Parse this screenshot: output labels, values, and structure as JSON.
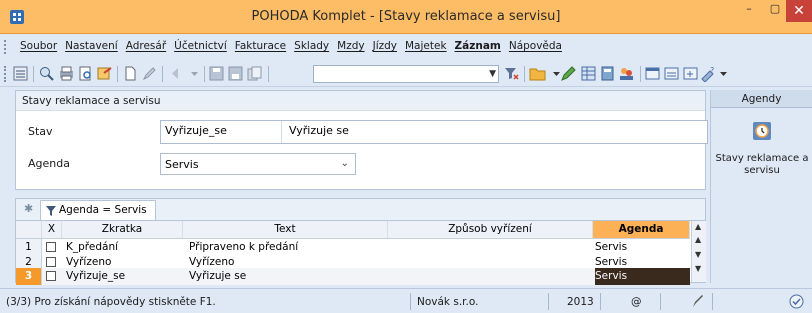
{
  "window": {
    "title": "POHODA Komplet - [Stavy reklamace a servisu]",
    "close_glyph": "✕",
    "min_glyph": "–",
    "max_glyph": "▢"
  },
  "menu": {
    "items": [
      {
        "label": "Soubor",
        "bold": false
      },
      {
        "label": "Nastavení",
        "bold": false
      },
      {
        "label": "Adresář",
        "bold": false
      },
      {
        "label": "Účetnictví",
        "bold": false
      },
      {
        "label": "Fakturace",
        "bold": false
      },
      {
        "label": "Sklady",
        "bold": false
      },
      {
        "label": "Mzdy",
        "bold": false
      },
      {
        "label": "Jízdy",
        "bold": false
      },
      {
        "label": "Majetek",
        "bold": false
      },
      {
        "label": "Záznam",
        "bold": true
      },
      {
        "label": "Nápověda",
        "bold": false
      }
    ]
  },
  "toolbar": {
    "search_value": ""
  },
  "form": {
    "title": "Stavy reklamace a servisu",
    "stav_label": "Stav",
    "stav_code": "Vyřizuje_se",
    "stav_text": "Vyřizuje se",
    "agenda_label": "Agenda",
    "agenda_value": "Servis"
  },
  "right_panel": {
    "header": "Agendy",
    "item_label": "Stavy reklamace a servisu"
  },
  "filter": {
    "star": "✱",
    "tab_label": "Agenda = Servis"
  },
  "grid": {
    "headers": {
      "x": "X",
      "zkratka": "Zkratka",
      "text": "Text",
      "zpusob": "Způsob vyřízení",
      "agenda": "Agenda"
    },
    "rows": [
      {
        "num": "1",
        "zkratka": "K_předání",
        "text": "Připraveno k předání",
        "zpusob": "",
        "agenda": "Servis"
      },
      {
        "num": "2",
        "zkratka": "Vyřízeno",
        "text": "Vyřízeno",
        "zpusob": "",
        "agenda": "Servis"
      },
      {
        "num": "3",
        "zkratka": "Vyřizuje_se",
        "text": "Vyřizuje se",
        "zpusob": "",
        "agenda": "Servis"
      }
    ]
  },
  "status": {
    "hint": "(3/3) Pro získání nápovědy stiskněte F1.",
    "company": "Novák s.r.o.",
    "year": "2013",
    "at": "@"
  },
  "colors": {
    "accent": "#fdbd66",
    "active_column": "#fdb157",
    "active_row_num": "#f59a2a",
    "close": "#c9423a"
  }
}
